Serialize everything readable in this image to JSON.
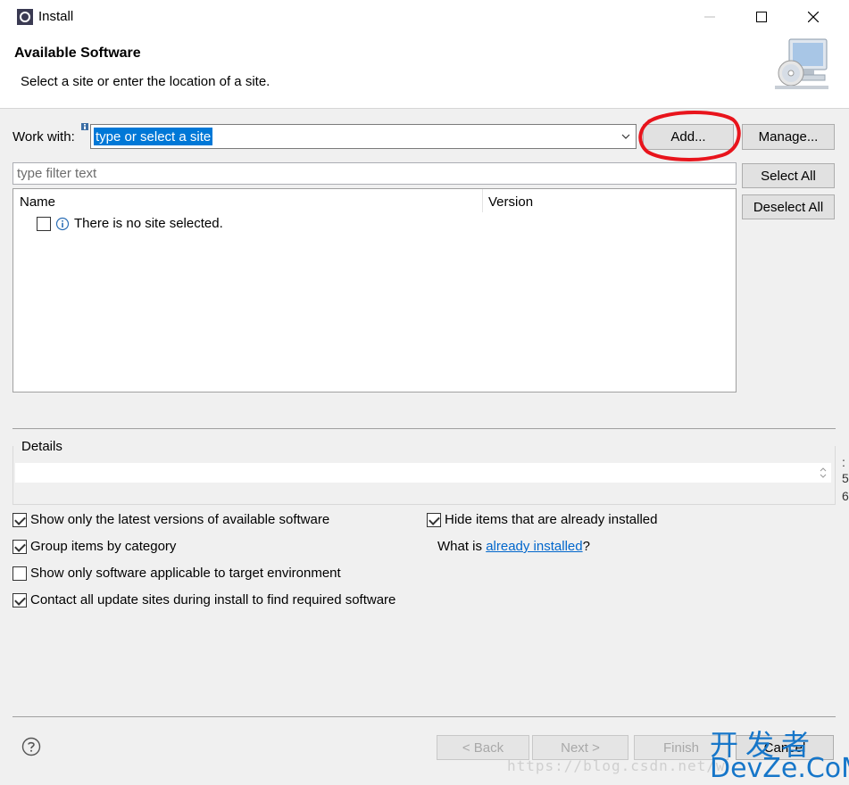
{
  "window": {
    "title": "Install"
  },
  "header": {
    "title": "Available Software",
    "subtitle": "Select a site or enter the location of a site."
  },
  "work_with": {
    "label": "Work with:",
    "value": "type or select a site",
    "add_label": "Add...",
    "manage_label": "Manage..."
  },
  "filter": {
    "placeholder": "type filter text"
  },
  "side_buttons": {
    "select_all": "Select All",
    "deselect_all": "Deselect All"
  },
  "table": {
    "columns": [
      "Name",
      "Version"
    ],
    "rows": [
      {
        "checked": false,
        "text": "There is no site selected."
      }
    ]
  },
  "details": {
    "label": "Details"
  },
  "edge_fragments": [
    ":",
    "5",
    "6"
  ],
  "options": {
    "latest_versions": {
      "label": "Show only the latest versions of available software",
      "checked": true
    },
    "group_by_category": {
      "label": "Group items by category",
      "checked": true
    },
    "target_env": {
      "label": "Show only software applicable to target environment",
      "checked": false
    },
    "contact_sites": {
      "label": "Contact all update sites during install to find required software",
      "checked": true
    },
    "hide_installed": {
      "label": "Hide items that are already installed",
      "checked": true
    },
    "what_is": {
      "prefix": "What is ",
      "link": "already installed",
      "suffix": "?"
    }
  },
  "footer": {
    "back": "< Back",
    "next": "Next >",
    "finish": "Finish",
    "cancel": "Cancel"
  },
  "watermark": {
    "url": "https://blog.csdn.net/w",
    "cn": "开发者",
    "en": "DevZe.CoM"
  },
  "colors": {
    "selection": "#0078d7",
    "annotation": "#e8141c",
    "link": "#0066cc"
  }
}
